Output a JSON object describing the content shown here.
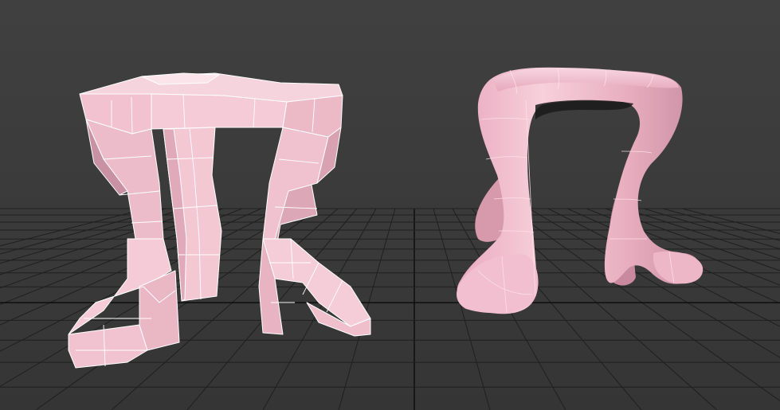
{
  "viewport": {
    "background": "#3a3a3a",
    "grid_color": "#1f1f1f",
    "grid_axis_color": "#0a0a0a"
  },
  "objects": [
    {
      "kind": "low-poly-stool",
      "shading": "faceted",
      "color": "#f3c6d3",
      "edge_color": "#ffffff"
    },
    {
      "kind": "subdivided-stool",
      "shading": "smooth",
      "color": "#f0b9cc",
      "edge_color": "#ffd9e6"
    }
  ]
}
